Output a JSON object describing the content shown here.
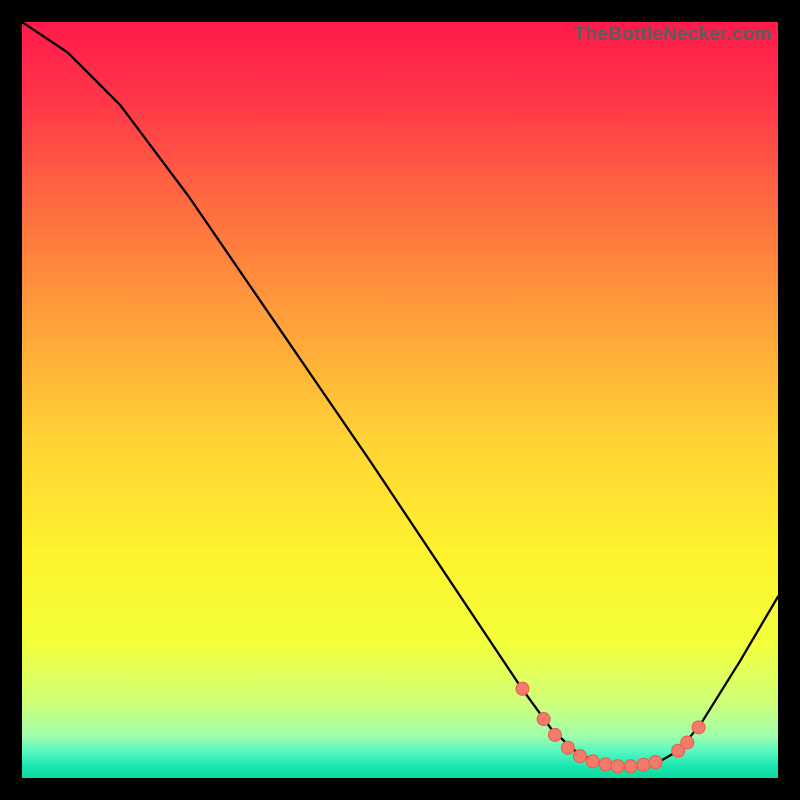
{
  "watermark": "TheBottleNecker.com",
  "chart_data": {
    "type": "line",
    "title": "",
    "xlabel": "",
    "ylabel": "",
    "xlim": [
      0,
      100
    ],
    "ylim": [
      0,
      100
    ],
    "gradient_stops": [
      {
        "offset": 0.0,
        "color": "#ff1a4b"
      },
      {
        "offset": 0.1,
        "color": "#ff3549"
      },
      {
        "offset": 0.25,
        "color": "#ff6e3f"
      },
      {
        "offset": 0.4,
        "color": "#ffa23a"
      },
      {
        "offset": 0.55,
        "color": "#ffd235"
      },
      {
        "offset": 0.7,
        "color": "#fff22e"
      },
      {
        "offset": 0.82,
        "color": "#f3ff3a"
      },
      {
        "offset": 0.9,
        "color": "#cfff78"
      },
      {
        "offset": 0.945,
        "color": "#9effac"
      },
      {
        "offset": 0.965,
        "color": "#56f7c0"
      },
      {
        "offset": 0.985,
        "color": "#18e7af"
      },
      {
        "offset": 1.0,
        "color": "#0cd99d"
      }
    ],
    "series": [
      {
        "name": "bottleneck-curve",
        "points": [
          {
            "x": 0.0,
            "y": 100.0
          },
          {
            "x": 6.0,
            "y": 96.0
          },
          {
            "x": 13.0,
            "y": 89.0
          },
          {
            "x": 22.0,
            "y": 77.0
          },
          {
            "x": 34.0,
            "y": 59.5
          },
          {
            "x": 46.0,
            "y": 42.0
          },
          {
            "x": 58.0,
            "y": 24.0
          },
          {
            "x": 66.0,
            "y": 12.0
          },
          {
            "x": 70.0,
            "y": 6.5
          },
          {
            "x": 73.0,
            "y": 3.7
          },
          {
            "x": 76.0,
            "y": 2.0
          },
          {
            "x": 80.0,
            "y": 1.5
          },
          {
            "x": 84.0,
            "y": 2.0
          },
          {
            "x": 87.0,
            "y": 3.7
          },
          {
            "x": 90.0,
            "y": 7.5
          },
          {
            "x": 95.0,
            "y": 15.5
          },
          {
            "x": 100.0,
            "y": 24.0
          }
        ]
      }
    ],
    "markers": [
      {
        "x": 66.2,
        "y": 11.8
      },
      {
        "x": 69.0,
        "y": 7.8
      },
      {
        "x": 70.5,
        "y": 5.7
      },
      {
        "x": 72.2,
        "y": 4.0
      },
      {
        "x": 73.8,
        "y": 2.9
      },
      {
        "x": 75.5,
        "y": 2.2
      },
      {
        "x": 77.2,
        "y": 1.8
      },
      {
        "x": 78.8,
        "y": 1.55
      },
      {
        "x": 80.5,
        "y": 1.55
      },
      {
        "x": 82.2,
        "y": 1.75
      },
      {
        "x": 83.8,
        "y": 2.1
      },
      {
        "x": 86.8,
        "y": 3.6
      },
      {
        "x": 88.0,
        "y": 4.7
      },
      {
        "x": 89.5,
        "y": 6.7
      }
    ],
    "marker_style": {
      "radius": 6.5,
      "fill": "#f47a6b",
      "stroke": "#e85c4a"
    }
  }
}
